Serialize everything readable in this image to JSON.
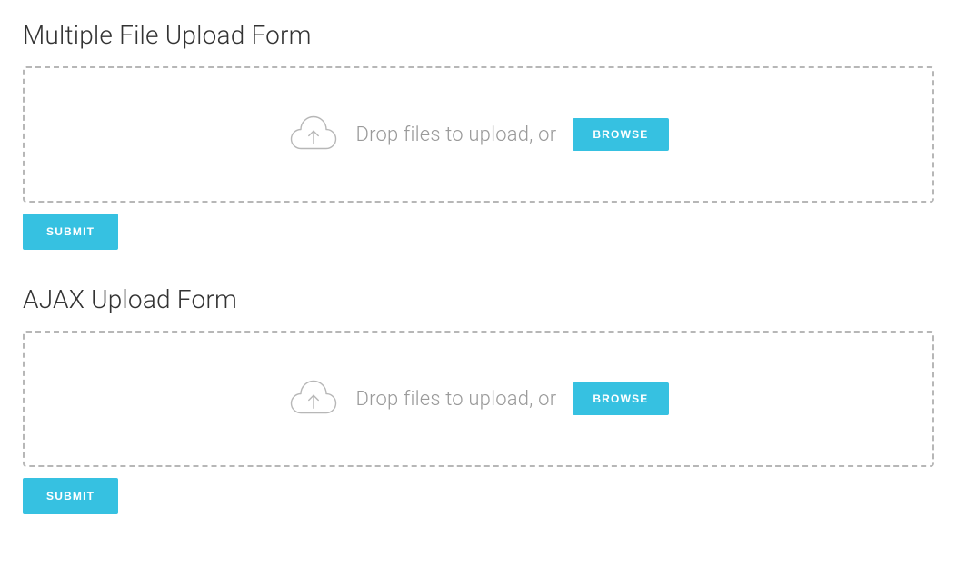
{
  "forms": [
    {
      "title": "Multiple File Upload Form",
      "drop_text": "Drop files to upload, or",
      "browse_label": "BROWSE",
      "submit_label": "SUBMIT"
    },
    {
      "title": "AJAX Upload Form",
      "drop_text": "Drop files to upload, or",
      "browse_label": "BROWSE",
      "submit_label": "SUBMIT"
    }
  ]
}
